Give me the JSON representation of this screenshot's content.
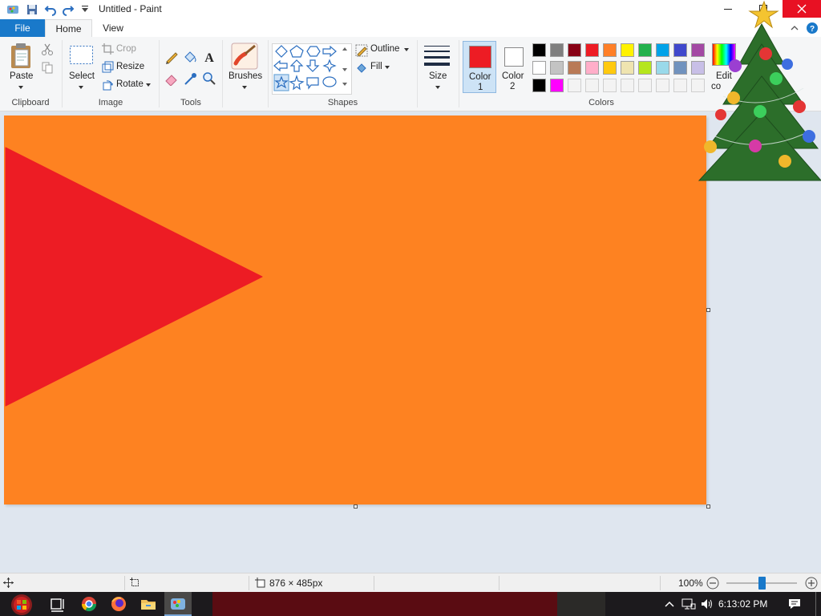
{
  "window": {
    "title": "Untitled - Paint",
    "buttons": [
      "minimize",
      "maximize",
      "close"
    ]
  },
  "tabs": [
    {
      "label": "File",
      "active": false
    },
    {
      "label": "Home",
      "active": true
    },
    {
      "label": "View",
      "active": false
    }
  ],
  "ribbon": {
    "clipboard": {
      "paste_label": "Paste",
      "group_label": "Clipboard"
    },
    "image": {
      "select_label": "Select",
      "crop_label": "Crop",
      "resize_label": "Resize",
      "rotate_label": "Rotate",
      "group_label": "Image"
    },
    "tools": {
      "group_label": "Tools"
    },
    "brushes": {
      "label": "Brushes"
    },
    "shapes": {
      "outline_label": "Outline",
      "fill_label": "Fill",
      "group_label": "Shapes"
    },
    "size": {
      "label": "Size"
    },
    "colors": {
      "color1_label": "Color",
      "color1_num": "1",
      "color2_label": "Color",
      "color2_num": "2",
      "edit_label": "Edit",
      "edit_label2": "co",
      "group_label": "Colors",
      "color1": "#ed1c24",
      "color2": "#ffffff",
      "palette_row1": [
        "#000000",
        "#7f7f7f",
        "#880015",
        "#ed1c24",
        "#ff7f27",
        "#fff200",
        "#22b14c",
        "#00a2e8",
        "#3f48cc",
        "#a349a4"
      ],
      "palette_row2": [
        "#ffffff",
        "#c3c3c3",
        "#b97a57",
        "#ffaec9",
        "#ffc90e",
        "#efe4b0",
        "#b5e61d",
        "#99d9ea",
        "#7092be",
        "#c8bfe7"
      ],
      "palette_row3": [
        "#000000",
        "#ff00ff"
      ]
    }
  },
  "canvas": {
    "background": "#fe8221",
    "shape_fill": "#ed1c24",
    "shape": "triangle"
  },
  "statusbar": {
    "size_text": "876 × 485px",
    "zoom_text": "100%"
  },
  "taskbar": {
    "time": "6:13:02 PM",
    "icons": [
      "start-icon",
      "task-view-icon",
      "chrome-icon",
      "firefox-icon",
      "file-explorer-icon",
      "paint-icon"
    ]
  }
}
